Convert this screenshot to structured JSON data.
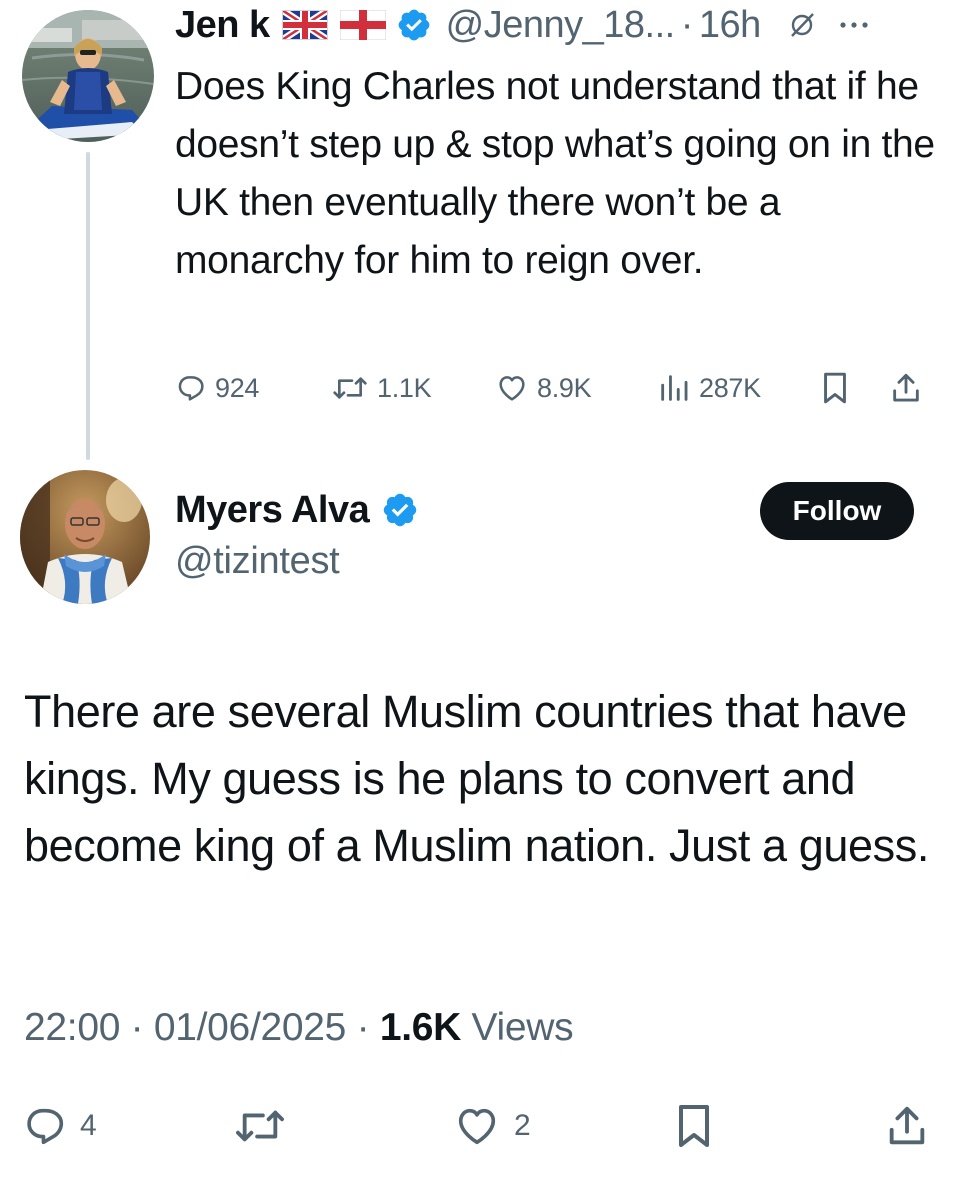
{
  "parent_tweet": {
    "display_name": "Jen k",
    "flags": [
      "uk-flag-icon",
      "england-flag-icon"
    ],
    "handle": "@Jenny_18...",
    "separator": "·",
    "time": "16h",
    "text": "Does King Charles not understand that if he doesn’t step up & stop what’s going on in the UK then eventually there won’t be a monarchy for him to reign over.",
    "stats": {
      "replies": "924",
      "reposts": "1.1K",
      "likes": "8.9K",
      "views": "287K"
    }
  },
  "reply": {
    "display_name": "Myers Alva",
    "handle": "@tizintest",
    "follow_label": "Follow",
    "text": "There are several Muslim countries that have kings. My guess is he plans to convert and become king of a Muslim nation. Just a guess.",
    "timestamp": "22:00 · 01/06/2025 · ",
    "views_count": "1.6K",
    "views_label": " Views",
    "stats": {
      "replies": "4",
      "likes": "2"
    }
  },
  "colors": {
    "verified_blue": "#1d9bf0",
    "secondary_text": "#536471",
    "primary_text": "#0f1419",
    "thread_line": "#cfd9de"
  }
}
